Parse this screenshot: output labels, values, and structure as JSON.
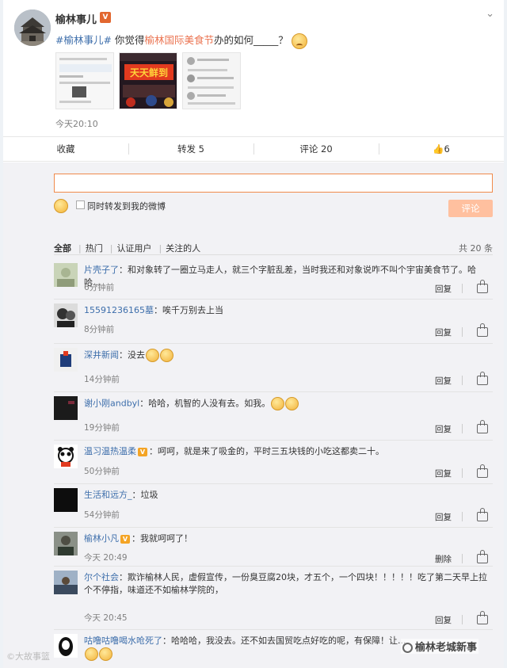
{
  "post": {
    "author": "榆林事儿",
    "verified_badge": "V",
    "hashtag": "#榆林事儿#",
    "text_before": " 你觉得",
    "topic_link": "榆林国际美食节",
    "text_after": "办的如何_____？",
    "time": "今天20:10",
    "thumb2_caption": "天天鲜到"
  },
  "actions": {
    "favorite": "收藏",
    "repost": "转发 5",
    "comment": "评论 20",
    "like": "6"
  },
  "composer": {
    "placeholder": "",
    "repost_label": "同时转发到我的微博",
    "submit": "评论"
  },
  "filters": {
    "all": "全部",
    "hot": "热门",
    "verified": "认证用户",
    "following": "关注的人",
    "total": "共 20 条"
  },
  "reply_label": "回复",
  "delete_label": "删除",
  "comments": [
    {
      "name": "片壳子了",
      "text": "：和对象转了一圈立马走人，就三个字脏乱差，当时我还和对象说咋不叫个宇宙美食节了。哈哈...",
      "time": "6分钟前",
      "avatar_color": "#c9d4b8"
    },
    {
      "name": "15591236165墓",
      "text": "：唉千万别去上当",
      "time": "8分钟前",
      "avatar_color": "#555555"
    },
    {
      "name": "深井新闻",
      "text": "：没去",
      "time": "14分钟前",
      "avatar_color": "#f0f0f0"
    },
    {
      "name": "谢小刚andbyl",
      "text": "：哈哈，机智的人没有去。如我。",
      "time": "19分钟前",
      "avatar_color": "#1b1b1b"
    },
    {
      "name": "温习温热温柔",
      "text": "：呵呵，就是来了吸金的，平时三五块钱的小吃这都卖二十。",
      "time": "50分钟前",
      "avatar_color": "#ffffff"
    },
    {
      "name": "生活和远方_",
      "text": "：垃圾",
      "time": "54分钟前",
      "avatar_color": "#0d0d0d"
    },
    {
      "name": "榆林小凡",
      "text": "：我就呵呵了！",
      "time": "今天 20:49",
      "avatar_color": "#6b6f66"
    },
    {
      "name": "尔个社会",
      "text": "：欺诈榆林人民，虚假宣传，一份臭豆腐20块，才五个，一个四块！！！！！吃了第二天早上拉个不停指，味道还不如榆林学院的，",
      "time": "今天 20:45",
      "avatar_color": "#3b4a5e"
    },
    {
      "name": "咕噜咕噜喝水呛死了",
      "text": "：哈哈哈，我没去。还不如去国贸吃点好吃的呢，有保障！让...",
      "time": "",
      "avatar_color": "#ffffff"
    }
  ],
  "watermark": {
    "left": "大故事篮",
    "right": "榆林老城新事"
  }
}
